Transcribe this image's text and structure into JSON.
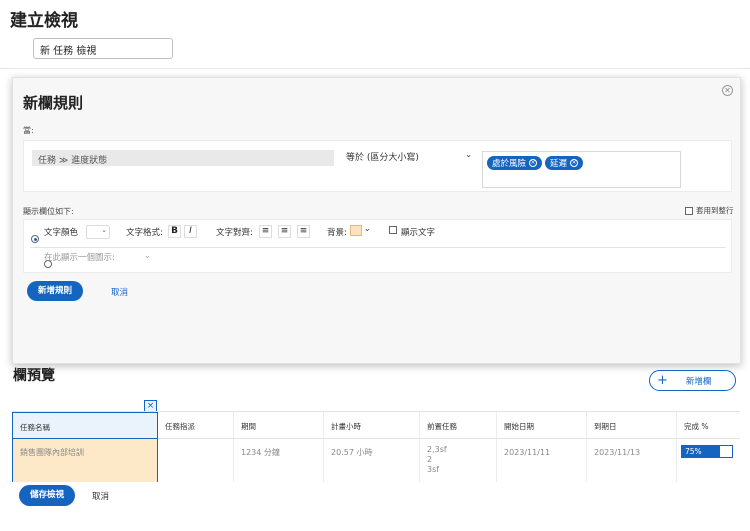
{
  "header": {
    "title": "建立檢視",
    "view_name_value": "新 任務 檢視"
  },
  "rule_panel": {
    "title": "新欄規則",
    "when_label": "當:",
    "field_path": "任務 ≫ 進度狀態",
    "operator": "等於 (區分大小寫)",
    "values": [
      "處於風險",
      "延遲"
    ],
    "display_label": "顯示欄位如下:",
    "apply_to_row_label": "套用到整行",
    "options": {
      "text_color_label": "文字顏色",
      "text_format_label": "文字格式:",
      "bold": "B",
      "italic": "I",
      "text_align_label": "文字對齊:",
      "background_label": "背景:",
      "background_color": "#fde2bd",
      "show_text_label": "顯示文字",
      "show_icon_label": "在此顯示一個圖示:"
    },
    "add_rule_label": "新增規則",
    "cancel_label": "取消"
  },
  "preview": {
    "title": "欄預覽",
    "new_column_label": "新增欄",
    "remove_column_symbol": "×",
    "columns": [
      "任務名稱",
      "任務指派",
      "期間",
      "計畫小時",
      "前置任務",
      "開始日期",
      "到期日",
      "完成 %"
    ],
    "row": {
      "task_name": "銷售團隊內部培訓",
      "assignment": "",
      "duration": "1234 分鐘",
      "planned_hours": "20.57 小時",
      "predecessors": [
        "2,3sf",
        "2",
        "3sf"
      ],
      "start_date": "2023/11/11",
      "due_date": "2023/11/13",
      "percent_complete_label": "75%",
      "percent_complete": 0.75
    }
  },
  "footer": {
    "save_label": "儲存檢視",
    "cancel_label": "取消"
  },
  "colors": {
    "accent": "#1565c0",
    "highlight_bg": "#fde9c8"
  }
}
